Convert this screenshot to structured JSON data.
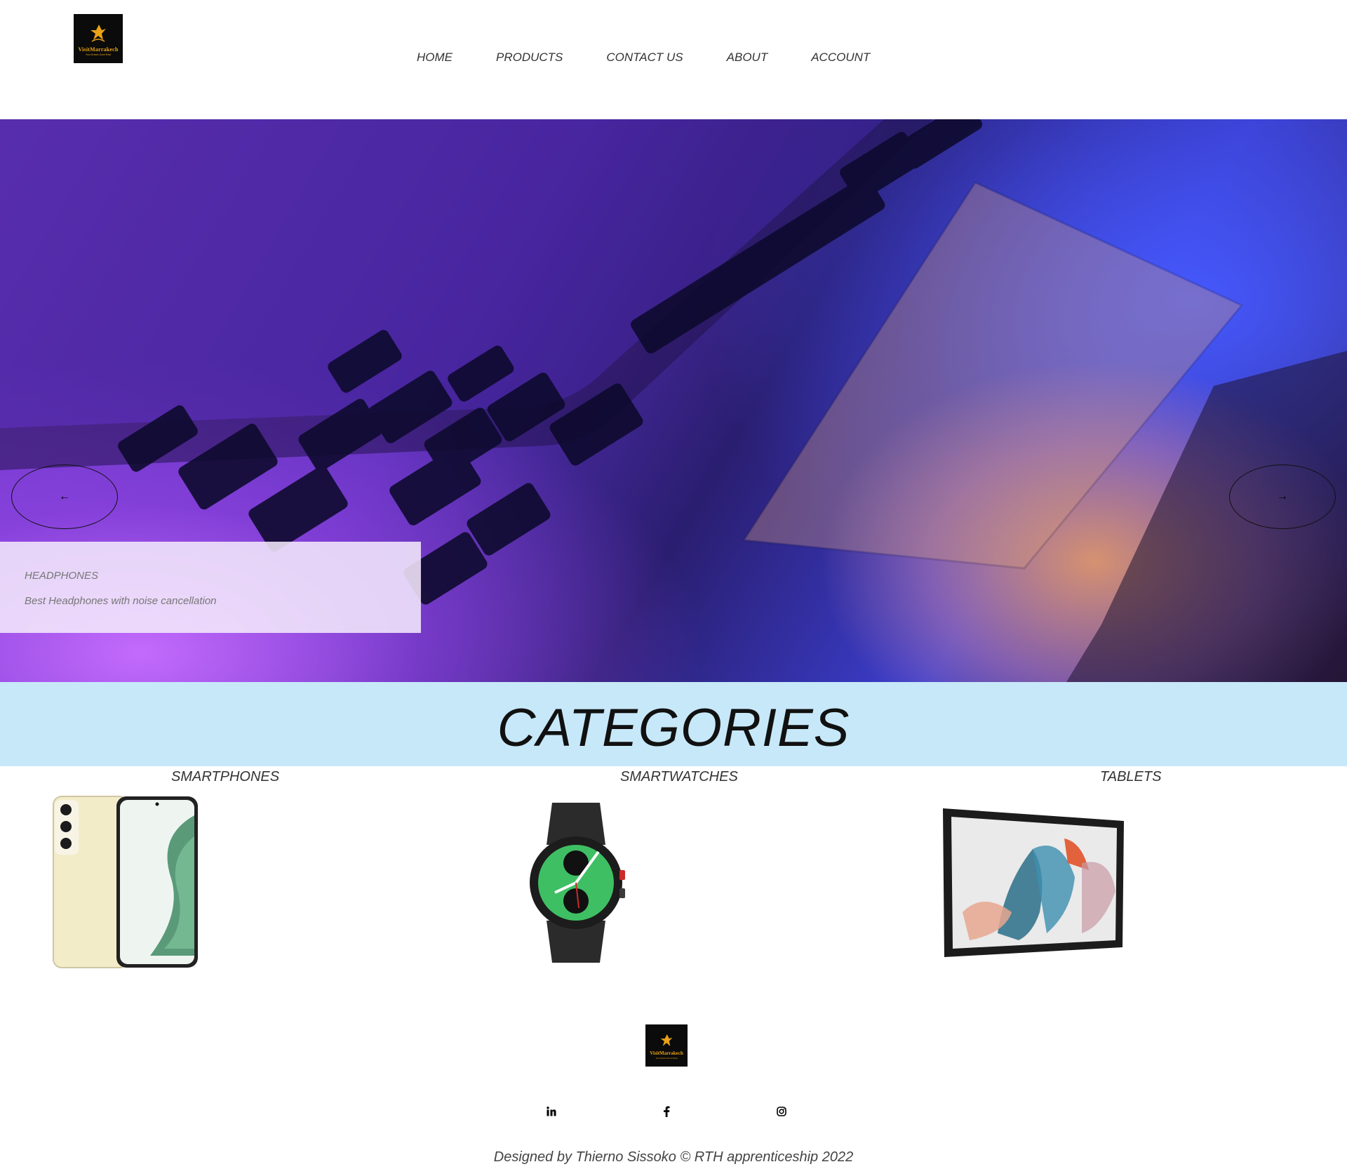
{
  "header": {
    "logo": {
      "brand": "VisitMarrakech",
      "tagline": "Your Dream Gone Real"
    },
    "nav": [
      "HOME",
      "PRODUCTS",
      "CONTACT US",
      "ABOUT",
      "ACCOUNT"
    ]
  },
  "hero": {
    "slide_title": "HEADPHONES",
    "slide_description": "Best Headphones with noise cancellation",
    "prev_icon": "arrow-left-icon",
    "next_icon": "arrow-right-icon"
  },
  "categories": {
    "heading": "CATEGORIES",
    "items": [
      {
        "label": "SMARTPHONES"
      },
      {
        "label": "SMARTWATCHES"
      },
      {
        "label": "TABLETS"
      }
    ]
  },
  "footer": {
    "logo": {
      "brand": "VisitMarrakech",
      "tagline": "Your Dream Gone Real"
    },
    "social": [
      "linkedin-icon",
      "facebook-icon",
      "instagram-icon"
    ],
    "credit": "Designed by Thierno Sissoko © RTH apprenticeship 2022"
  },
  "colors": {
    "band": "#c7e8f8",
    "logo_bg": "#0b0b0b",
    "logo_gold": "#e8a317",
    "watch_face": "#3fbf63"
  }
}
